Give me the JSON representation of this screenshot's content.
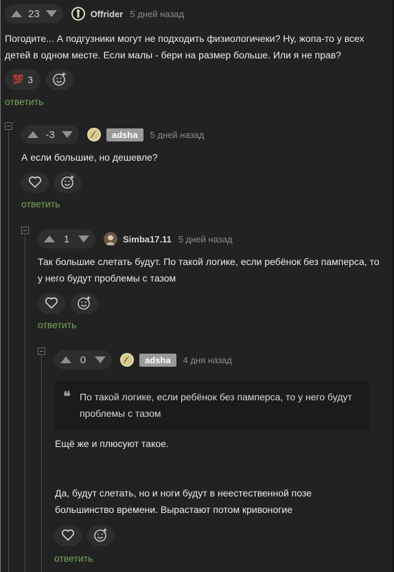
{
  "comments": [
    {
      "votes": "23",
      "username": "Offrider",
      "time": "5 дней назад",
      "text": "Погодите... А подгузники могут не подходить физиологичеки? Ну, жопа-то у всех детей в одном месте. Если малы - бери на размер больше. Или я не прав?",
      "reaction_emoji": "💯",
      "reaction_count": "3",
      "reply": "ответить"
    },
    {
      "votes": "-3",
      "username": "adsha",
      "time": "5 дней назад",
      "text": "А если большие, но дешевле?",
      "reply": "ответить"
    },
    {
      "votes": "1",
      "username": "Simba17.11",
      "time": "5 дней назад",
      "text": "Так большие слетать будут. По такой логике, если ребёнок без памперса, то у него будут проблемы с тазом",
      "reply": "ответить"
    },
    {
      "votes": "0",
      "username": "adsha",
      "time": "4 дня назад",
      "quote": "По такой логике, если ребёнок без памперса, то у него будут проблемы с тазом",
      "text1": "Ещё же и плюсуют такое.",
      "text2": "Да, будут слетать, но и ноги будут в неестественной позе большинство времени. Вырастают потом кривоногие",
      "reply": "ответить"
    }
  ],
  "icons": {
    "upvote": "arrow-up-icon",
    "downvote": "arrow-down-icon",
    "like": "heart-icon",
    "add_reaction": "emoji-add-icon",
    "quote": "quote-icon",
    "collapse": "collapse-minus-icon"
  },
  "colors": {
    "background": "#222222",
    "reply_link": "#78a75a",
    "op_badge": "#9a9a9a"
  }
}
